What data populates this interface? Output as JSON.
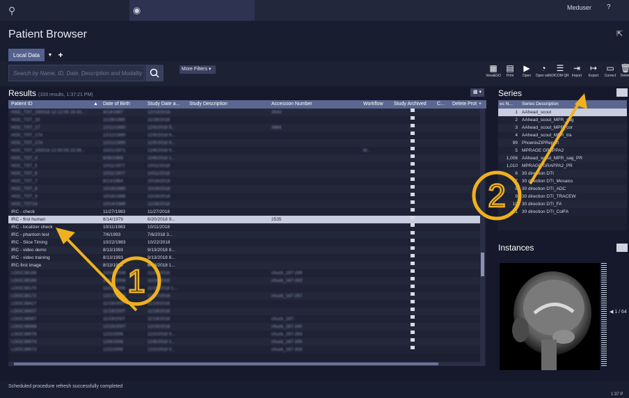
{
  "topbar": {
    "user": "Meduser",
    "help": "?"
  },
  "browser": {
    "title": "Patient Browser",
    "data_tab": "Local Data"
  },
  "search": {
    "placeholder": "Search by Name, ID, Date, Description and Modality (Ctrl+F)",
    "more_filters": "More Filters"
  },
  "toolbar": [
    {
      "label": "View&GO",
      "icon": "view-go-icon"
    },
    {
      "label": "Print",
      "icon": "print-icon"
    },
    {
      "label": "Open",
      "icon": "open-icon"
    },
    {
      "label": "Open with",
      "icon": "open-with-icon"
    },
    {
      "label": "DICOM QR",
      "icon": "dicom-qr-icon"
    },
    {
      "label": "Import",
      "icon": "import-icon"
    },
    {
      "label": "Export",
      "icon": "export-icon"
    },
    {
      "label": "Correct",
      "icon": "correct-icon"
    },
    {
      "label": "Delete",
      "icon": "delete-icon"
    }
  ],
  "results": {
    "title": "Results",
    "count": "(333 results, 1:37:21 PM)",
    "columns": [
      "Patient ID",
      "Date of Birth",
      "Study Date a...",
      "Study Description",
      "Accession Number",
      "Workflow",
      "Study Archived",
      "C...",
      "Delete Prot"
    ],
    "rows": [
      {
        "id": "HOC_TST_150018 12:12:09 16:43...",
        "dob": "4/13/1997",
        "sd": "12/13/2018",
        "acc": "3543",
        "wf": "",
        "blur": true
      },
      {
        "id": "HOC_TST_15",
        "dob": "11/28/1985",
        "sd": "11/28/2018",
        "acc": "",
        "wf": "",
        "blur": true
      },
      {
        "id": "HOC_TST_17",
        "dob": "12/12/1990",
        "sd": "12/5/2018 9...",
        "acc": "3884",
        "wf": "",
        "blur": true
      },
      {
        "id": "HOC_TST_17A",
        "dob": "12/12/1990",
        "sd": "12/5/2018 9...",
        "acc": "",
        "wf": "",
        "blur": true
      },
      {
        "id": "HOC_TST_17A",
        "dob": "12/12/1990",
        "sd": "12/5/2018 9...",
        "acc": "",
        "wf": "",
        "blur": true
      },
      {
        "id": "HOC_TST_150018 12:00:09 23:09...",
        "dob": "10/21/1971",
        "sd": "12/6/2018 9...",
        "acc": "",
        "wf": "M...",
        "blur": true
      },
      {
        "id": "HOC_TST_4",
        "dob": "8/30/1969",
        "sd": "10/9/2018 1...",
        "acc": "",
        "wf": "",
        "blur": true
      },
      {
        "id": "HOC_TST_5",
        "dob": "10/11/1977",
        "sd": "10/11/2018",
        "acc": "",
        "wf": "",
        "blur": true
      },
      {
        "id": "HOC_TST_6",
        "dob": "10/11/1977",
        "sd": "10/11/2018",
        "acc": "",
        "wf": "",
        "blur": true
      },
      {
        "id": "HOC_TST_7",
        "dob": "8/13/1964",
        "sd": "10/16/2018",
        "acc": "",
        "wf": "",
        "blur": true
      },
      {
        "id": "HOC_TST_8",
        "dob": "10/16/1985",
        "sd": "10/16/2018",
        "acc": "",
        "wf": "",
        "blur": true
      },
      {
        "id": "HOC_TST_9",
        "dob": "10/16/1986",
        "sd": "10/16/2018",
        "acc": "",
        "wf": "",
        "blur": true
      },
      {
        "id": "HOC_TST14",
        "dob": "10/14/1986",
        "sd": "11/28/2018",
        "acc": "",
        "wf": "",
        "blur": true
      },
      {
        "id": "IRC - check",
        "dob": "11/27/1983",
        "sd": "11/27/2018",
        "acc": "",
        "wf": "",
        "blur": false
      },
      {
        "id": "IRC - first human",
        "dob": "8/14/1979",
        "sd": "6/20/2018 9...",
        "acc": "2535",
        "wf": "",
        "blur": false,
        "selected": true
      },
      {
        "id": "IRC - localizer check",
        "dob": "10/11/1983",
        "sd": "10/11/2018",
        "acc": "",
        "wf": "",
        "blur": false
      },
      {
        "id": "IRC - phantom test",
        "dob": "7/6/1993",
        "sd": "7/6/2018 3...",
        "acc": "",
        "wf": "",
        "blur": false
      },
      {
        "id": "IRC - Slice Timing",
        "dob": "10/22/1983",
        "sd": "10/22/2018",
        "acc": "",
        "wf": "",
        "blur": false
      },
      {
        "id": "IRC - video demo",
        "dob": "8/13/1993",
        "sd": "9/13/2018 8...",
        "acc": "",
        "wf": "",
        "blur": false
      },
      {
        "id": "IRC - video training",
        "dob": "8/13/1993",
        "sd": "9/13/2018 8...",
        "acc": "",
        "wf": "",
        "blur": false
      },
      {
        "id": "IRC-first image",
        "dob": "8/13/1993",
        "sd": "6/13/2018 1...",
        "acc": "",
        "wf": "",
        "blur": false
      },
      {
        "id": "LOOC38168",
        "dob": "10/24/2008",
        "sd": "11/24/2018",
        "acc": "chuck_167-289",
        "wf": "",
        "blur": true
      },
      {
        "id": "LOOC38169",
        "dob": "10/24/2008",
        "sd": "11/24/2018",
        "acc": "chuck_167-283",
        "wf": "",
        "blur": true
      },
      {
        "id": "LOOC38170",
        "dob": "11/29/2006",
        "sd": "11/29/2018 1...",
        "acc": "",
        "wf": "",
        "blur": true
      },
      {
        "id": "LOOC38172",
        "dob": "12/17/2006",
        "sd": "12/17/2018",
        "acc": "chuck_167-267",
        "wf": "",
        "blur": true
      },
      {
        "id": "LOOC38417",
        "dob": "11/19/2007",
        "sd": "11/19/2018",
        "acc": "",
        "wf": "",
        "blur": true
      },
      {
        "id": "LOOC38437",
        "dob": "11/19/2007",
        "sd": "11/19/2018",
        "acc": "",
        "wf": "",
        "blur": true
      },
      {
        "id": "LOOC38567",
        "dob": "11/19/2007",
        "sd": "11/19/2018",
        "acc": "chuck_167-",
        "wf": "",
        "blur": true
      },
      {
        "id": "LOOC38568",
        "dob": "12/15/2007",
        "sd": "12/15/2018",
        "acc": "chuck_167-240",
        "wf": "",
        "blur": true
      },
      {
        "id": "LOOC38578",
        "dob": "12/2/2006",
        "sd": "12/2/2018 5...",
        "acc": "chuck_167-263",
        "wf": "",
        "blur": true
      },
      {
        "id": "LOOC38574",
        "dob": "12/8/2006",
        "sd": "12/8/2018 1...",
        "acc": "chuck_167-305",
        "wf": "",
        "blur": true
      },
      {
        "id": "LOOC38573",
        "dob": "12/2/2006",
        "sd": "12/2/2018 5...",
        "acc": "chuck_167-303",
        "wf": "",
        "blur": true
      }
    ]
  },
  "series": {
    "title": "Series",
    "columns": [
      "es N...",
      "Series Description"
    ],
    "rows": [
      {
        "n": "1",
        "d": "AAhead_scout",
        "selected": true
      },
      {
        "n": "2",
        "d": "AAhead_scout_MPR_sag"
      },
      {
        "n": "3",
        "d": "AAhead_scout_MPR_cor"
      },
      {
        "n": "4",
        "d": "AAhead_scout_MPR_tra"
      },
      {
        "n": "99",
        "d": "PhoenixZIPReport"
      },
      {
        "n": "5",
        "d": "MPRAGE GRAPPA2"
      },
      {
        "n": "1,006",
        "d": "AAhead_scout_MPR_sag_PR"
      },
      {
        "n": "1,010",
        "d": "MPRAGE GRAPPA2_PR"
      },
      {
        "n": "6",
        "d": "30 direction DTI"
      },
      {
        "n": "7",
        "d": "30 direction DTI_Mosaics"
      },
      {
        "n": "8",
        "d": "30 direction DTI_ADC"
      },
      {
        "n": "9",
        "d": "30 direction DTI_TRACEW"
      },
      {
        "n": "10",
        "d": "30 direction DTI_FA"
      },
      {
        "n": "11",
        "d": "30 direction DTI_ColFA"
      }
    ]
  },
  "instances": {
    "title": "Instances",
    "count": "1 / 64"
  },
  "status": {
    "message": "Scheduled procedure refresh successfully completed",
    "time": "1:37 P"
  },
  "annotations": [
    {
      "label": "1"
    },
    {
      "label": "2"
    }
  ],
  "colors": {
    "header": "#5b6790",
    "selected": "#c9cde0",
    "annotation": "#f0b11e",
    "background": "#1b1f30"
  }
}
